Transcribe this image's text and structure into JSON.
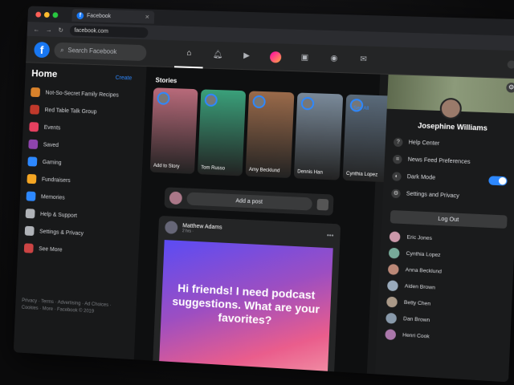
{
  "browser": {
    "tab_title": "Facebook",
    "url": "facebook.com"
  },
  "topbar": {
    "logo": "f",
    "search_placeholder": "Search Facebook",
    "nav": [
      {
        "icon": "home-icon",
        "active": true
      },
      {
        "icon": "bell-icon"
      },
      {
        "icon": "video-icon"
      },
      {
        "icon": "avatar"
      },
      {
        "icon": "marketplace-icon"
      },
      {
        "icon": "groups-icon"
      },
      {
        "icon": "messenger-icon"
      }
    ]
  },
  "left": {
    "title": "Home",
    "create": "Create",
    "items": [
      {
        "label": "Not-So-Secret Family Recipes",
        "color": "#d9822b"
      },
      {
        "label": "Red Table Talk Group",
        "color": "#c0392b"
      },
      {
        "label": "Events",
        "color": "#e4405f"
      },
      {
        "label": "Saved",
        "color": "#8e44ad"
      },
      {
        "label": "Gaming",
        "color": "#2d88ff"
      },
      {
        "label": "Fundraisers",
        "color": "#f5a623"
      },
      {
        "label": "Memories",
        "color": "#2d88ff"
      },
      {
        "label": "Help & Support",
        "color": "#b0b3b8"
      },
      {
        "label": "Settings & Privacy",
        "color": "#b0b3b8"
      },
      {
        "label": "See More",
        "color": "#c44"
      }
    ],
    "footer": "Privacy · Terms · Advertising · Ad Choices · Cookies · More · Facebook © 2019"
  },
  "center": {
    "stories_label": "Stories",
    "see_all": "See All",
    "stories": [
      {
        "name": "Add to Story",
        "color": "#b86a7a"
      },
      {
        "name": "Tom Russo",
        "color": "#3aa07a"
      },
      {
        "name": "Amy Becklund",
        "color": "#9a6a4a"
      },
      {
        "name": "Dennis Han",
        "color": "#7a8a9a"
      },
      {
        "name": "Cynthia Lopez",
        "color": "#5a6a7a"
      }
    ],
    "add_post": "Add a post",
    "post": {
      "author": "Matthew Adams",
      "time": "2 hrs · ",
      "text": "Hi friends! I need podcast suggestions. What are your favorites?"
    }
  },
  "right": {
    "name": "Josephine Williams",
    "menu": [
      {
        "label": "Help Center",
        "icon": "?"
      },
      {
        "label": "News Feed Preferences",
        "icon": "≡"
      },
      {
        "label": "Dark Mode",
        "icon": "◐",
        "toggle": true
      },
      {
        "label": "Settings and Privacy",
        "icon": "⚙"
      }
    ],
    "logout": "Log Out",
    "contacts": [
      {
        "name": "Eric Jones",
        "color": "#c9a"
      },
      {
        "name": "Cynthia Lopez",
        "color": "#7a9"
      },
      {
        "name": "Anna Becklund",
        "color": "#b87"
      },
      {
        "name": "Aiden Brown",
        "color": "#9ab"
      },
      {
        "name": "Betty Chen",
        "color": "#a98"
      },
      {
        "name": "Dan Brown",
        "color": "#89a"
      },
      {
        "name": "Henri Cook",
        "color": "#a7a"
      }
    ]
  }
}
